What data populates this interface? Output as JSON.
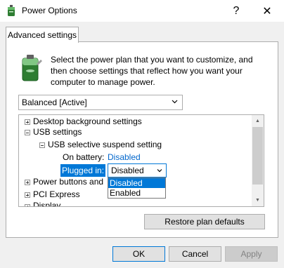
{
  "window": {
    "title": "Power Options",
    "help_glyph": "?",
    "close_glyph": "✕"
  },
  "tab": {
    "label": "Advanced settings"
  },
  "description": "Select the power plan that you want to customize, and then choose settings that reflect how you want your computer to manage power.",
  "plan_select": {
    "value": "Balanced [Active]"
  },
  "tree": {
    "desktop_background": "Desktop background settings",
    "usb_settings": "USB settings",
    "usb_selective_suspend": "USB selective suspend setting",
    "on_battery_label": "On battery:",
    "on_battery_value": "Disabled",
    "plugged_in_label": "Plugged in:",
    "plugged_in_value": "Disabled",
    "power_buttons": "Power buttons and",
    "pci_express": "PCI Express",
    "display": "Display"
  },
  "dropdown": {
    "options": [
      "Disabled",
      "Enabled"
    ],
    "selected": "Disabled"
  },
  "buttons": {
    "restore": "Restore plan defaults",
    "ok": "OK",
    "cancel": "Cancel",
    "apply": "Apply"
  },
  "colors": {
    "accent": "#0078d7",
    "link": "#0066cc"
  }
}
